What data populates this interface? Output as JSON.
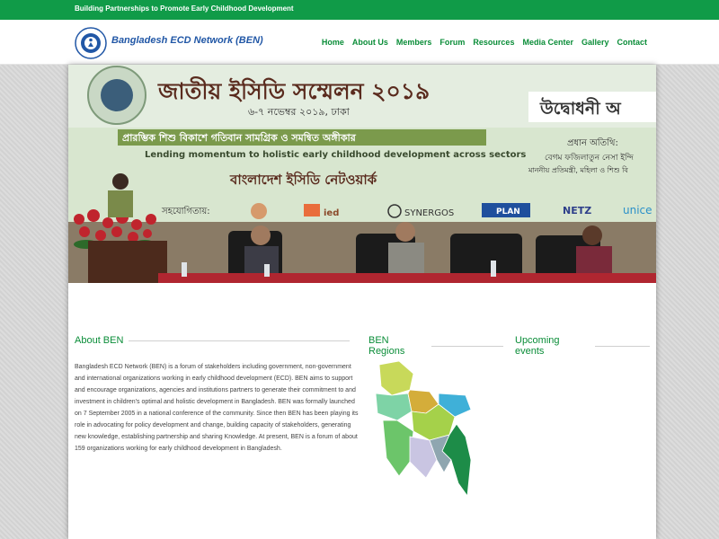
{
  "topbar": {
    "tagline": "Building Partnerships to Promote Early Childhood Development"
  },
  "header": {
    "brand": "Bangladesh ECD Network (BEN)",
    "nav": [
      "Home",
      "About Us",
      "Members",
      "Forum",
      "Resources",
      "Media Center",
      "Gallery",
      "Contact"
    ]
  },
  "hero": {
    "banner_title": "জাতীয় ইসিডি সম্মেলন ২০১৯",
    "banner_date": "৬-৭ নভেম্বর ২০১৯, ঢাকা",
    "banner_theme_bn": "প্রারম্ভিক শিশু বিকাশে গতিবান সামগ্রিক ও সমন্বিত অঙ্গীকার",
    "banner_theme_en": "Lending momentum to holistic early childhood development across sectors",
    "banner_org": "বাংলাদেশ ইসিডি নেটওয়ার্ক",
    "banner_inaug": "উদ্বোধনী অ",
    "banner_guest": "প্রধান অতিথি:",
    "banner_guest_name": "বেগম ফজিলাতুন নেসা ইন্দি",
    "banner_guest_title": "মাননীয় প্রতিমন্ত্রী, মহিলা ও শিশু বি",
    "banner_support": "সহযোগিতায়:",
    "sponsors": [
      "ied",
      "SYNERGOS",
      "PLAN",
      "NETZ",
      "unice"
    ]
  },
  "sections": {
    "about_title": "About BEN",
    "regions_title": "BEN Regions",
    "events_title": "Upcoming events"
  },
  "about_text": "Bangladesh ECD Network (BEN) is a forum of stakeholders including government, non-government and international organizations working in early childhood development (ECD). BEN aims to support and encourage organizations, agencies and institutions partners to generate their commitment to and investment in children's optimal and holistic development in Bangladesh. BEN was formally launched on 7 September 2005 in a national conference of the community. Since then BEN has been playing its role in advocating for policy development and change, building capacity of stakeholders, generating new knowledge, establishing partnership and sharing Knowledge. At present, BEN is a forum of about 159 organizations working for early childhood development in Bangladesh.",
  "colors": {
    "topbar": "#109b48",
    "nav_text": "#0a8d38",
    "brand_text": "#2157a6",
    "heading_text": "#0a8d38"
  }
}
